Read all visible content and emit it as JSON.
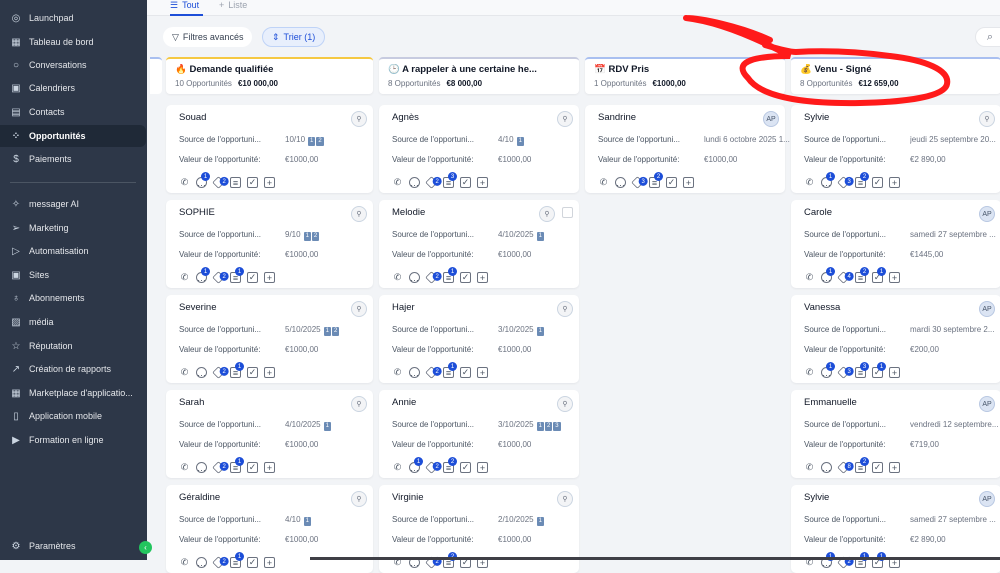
{
  "sidebar": {
    "items": [
      {
        "label": "Launchpad",
        "icon": "rocket-icon",
        "glyph": "◎"
      },
      {
        "label": "Tableau de bord",
        "icon": "dashboard-icon",
        "glyph": "▦"
      },
      {
        "label": "Conversations",
        "icon": "chat-icon",
        "glyph": "○"
      },
      {
        "label": "Calendriers",
        "icon": "calendar-icon",
        "glyph": "▣"
      },
      {
        "label": "Contacts",
        "icon": "contacts-icon",
        "glyph": "▤"
      },
      {
        "label": "Opportunités",
        "icon": "opportunities-icon",
        "glyph": "⁘",
        "active": true
      },
      {
        "label": "Paiements",
        "icon": "payments-icon",
        "glyph": "$"
      },
      {
        "label": "messager AI",
        "icon": "sparkle-icon",
        "glyph": "✧"
      },
      {
        "label": "Marketing",
        "icon": "send-icon",
        "glyph": "➢"
      },
      {
        "label": "Automatisation",
        "icon": "automation-icon",
        "glyph": "▷"
      },
      {
        "label": "Sites",
        "icon": "sites-icon",
        "glyph": "▣"
      },
      {
        "label": "Abonnements",
        "icon": "badge-icon",
        "glyph": "♁"
      },
      {
        "label": "média",
        "icon": "image-icon",
        "glyph": "▨"
      },
      {
        "label": "Réputation",
        "icon": "star-icon",
        "glyph": "☆"
      },
      {
        "label": "Création de rapports",
        "icon": "chart-icon",
        "glyph": "↗"
      },
      {
        "label": "Marketplace d'applicatio...",
        "icon": "apps-icon",
        "glyph": "▦"
      },
      {
        "label": "Application mobile",
        "icon": "mobile-icon",
        "glyph": "▯"
      },
      {
        "label": "Formation en ligne",
        "icon": "youtube-icon",
        "glyph": "▶"
      }
    ],
    "settings": "Paramètres"
  },
  "tabs": [
    {
      "label": "Tout"
    },
    {
      "label": "Liste"
    }
  ],
  "filters": {
    "advanced": "Filtres avancés",
    "sort": "Trier (1)"
  },
  "labels": {
    "source": "Source de l'opportuni...",
    "value": "Valeur de l'opportunité:"
  },
  "columns": [
    {
      "title": "🔥 Demande qualifiée",
      "count": "10 Opportunités",
      "total": "€10 000,00",
      "accent": "#f5c842",
      "cards": [
        {
          "name": "Souad",
          "source": "10/10",
          "tags": [
            "1",
            "2"
          ],
          "value": "€1000,00",
          "badges": [
            0,
            1,
            2,
            0,
            0,
            0
          ]
        },
        {
          "name": "SOPHIE",
          "source": "9/10",
          "tags": [
            "1",
            "2"
          ],
          "value": "€1000,00",
          "badges": [
            0,
            1,
            2,
            1,
            0,
            0
          ]
        },
        {
          "name": "Severine",
          "source": "5/10/2025",
          "tags": [
            "1",
            "2"
          ],
          "value": "€1000,00",
          "badges": [
            0,
            0,
            2,
            1,
            0,
            0
          ]
        },
        {
          "name": "Sarah",
          "source": "4/10/2025",
          "tags": [
            "1"
          ],
          "value": "€1000,00",
          "badges": [
            0,
            0,
            2,
            1,
            0,
            0
          ]
        },
        {
          "name": "Géraldine",
          "source": "4/10",
          "tags": [
            "1"
          ],
          "value": "€1000,00",
          "badges": [
            0,
            0,
            2,
            1,
            0,
            0
          ]
        }
      ]
    },
    {
      "title": "🕒 A rappeler à une certaine he...",
      "count": "8 Opportunités",
      "total": "€8 000,00",
      "accent": "#c7cbe0",
      "cards": [
        {
          "name": "Agnès",
          "source": "4/10",
          "tags": [
            "1"
          ],
          "value": "€1000,00",
          "badges": [
            0,
            0,
            2,
            3,
            0,
            0
          ]
        },
        {
          "name": "Melodie",
          "source": "4/10/2025",
          "tags": [
            "1"
          ],
          "value": "€1000,00",
          "badges": [
            0,
            0,
            2,
            1,
            0,
            0
          ],
          "checkbox": true
        },
        {
          "name": "Hajer",
          "source": "3/10/2025",
          "tags": [
            "1"
          ],
          "value": "€1000,00",
          "badges": [
            0,
            0,
            2,
            1,
            0,
            0
          ]
        },
        {
          "name": "Annie",
          "source": "3/10/2025",
          "tags": [
            "1",
            "2",
            "3"
          ],
          "value": "€1000,00",
          "badges": [
            0,
            1,
            2,
            2,
            0,
            0
          ]
        },
        {
          "name": "Virginie",
          "source": "2/10/2025",
          "tags": [
            "1"
          ],
          "value": "€1000,00",
          "badges": [
            0,
            0,
            2,
            2,
            0,
            0
          ]
        }
      ]
    },
    {
      "title": "📅 RDV Pris",
      "count": "1 Opportunités",
      "total": "€1000,00",
      "accent": "#a9bff0",
      "cards": [
        {
          "name": "Sandrine",
          "source": "lundi 6 octobre 2025 1...",
          "tags": [],
          "value": "€1000,00",
          "badges": [
            0,
            0,
            3,
            2,
            0,
            0
          ],
          "avatar": "AP"
        }
      ]
    },
    {
      "title": "💰 Venu - Signé",
      "count": "8 Opportunités",
      "total": "€12 659,00",
      "accent": "#a9bff0",
      "cards": [
        {
          "name": "Sylvie",
          "source": "jeudi 25 septembre 20...",
          "tags": [],
          "value": "€2 890,00",
          "badges": [
            0,
            1,
            3,
            2,
            0,
            0
          ]
        },
        {
          "name": "Carole",
          "source": "samedi 27 septembre ...",
          "tags": [],
          "value": "€1445,00",
          "badges": [
            0,
            1,
            4,
            2,
            1,
            0
          ],
          "avatar": "AP"
        },
        {
          "name": "Vanessa",
          "source": "mardi 30 septembre 2...",
          "tags": [],
          "value": "€200,00",
          "badges": [
            0,
            1,
            3,
            3,
            1,
            0
          ],
          "avatar": "AP"
        },
        {
          "name": "Emmanuelle",
          "source": "vendredi 12 septembre...",
          "tags": [],
          "value": "€719,00",
          "badges": [
            0,
            0,
            8,
            2,
            0,
            0
          ],
          "avatar": "AP"
        },
        {
          "name": "Sylvie",
          "source": "samedi 27 septembre ...",
          "tags": [],
          "value": "€2 890,00",
          "badges": [
            0,
            1,
            2,
            1,
            1,
            0
          ],
          "avatar": "AP"
        }
      ]
    }
  ],
  "annotation_color": "#ff1a1a"
}
